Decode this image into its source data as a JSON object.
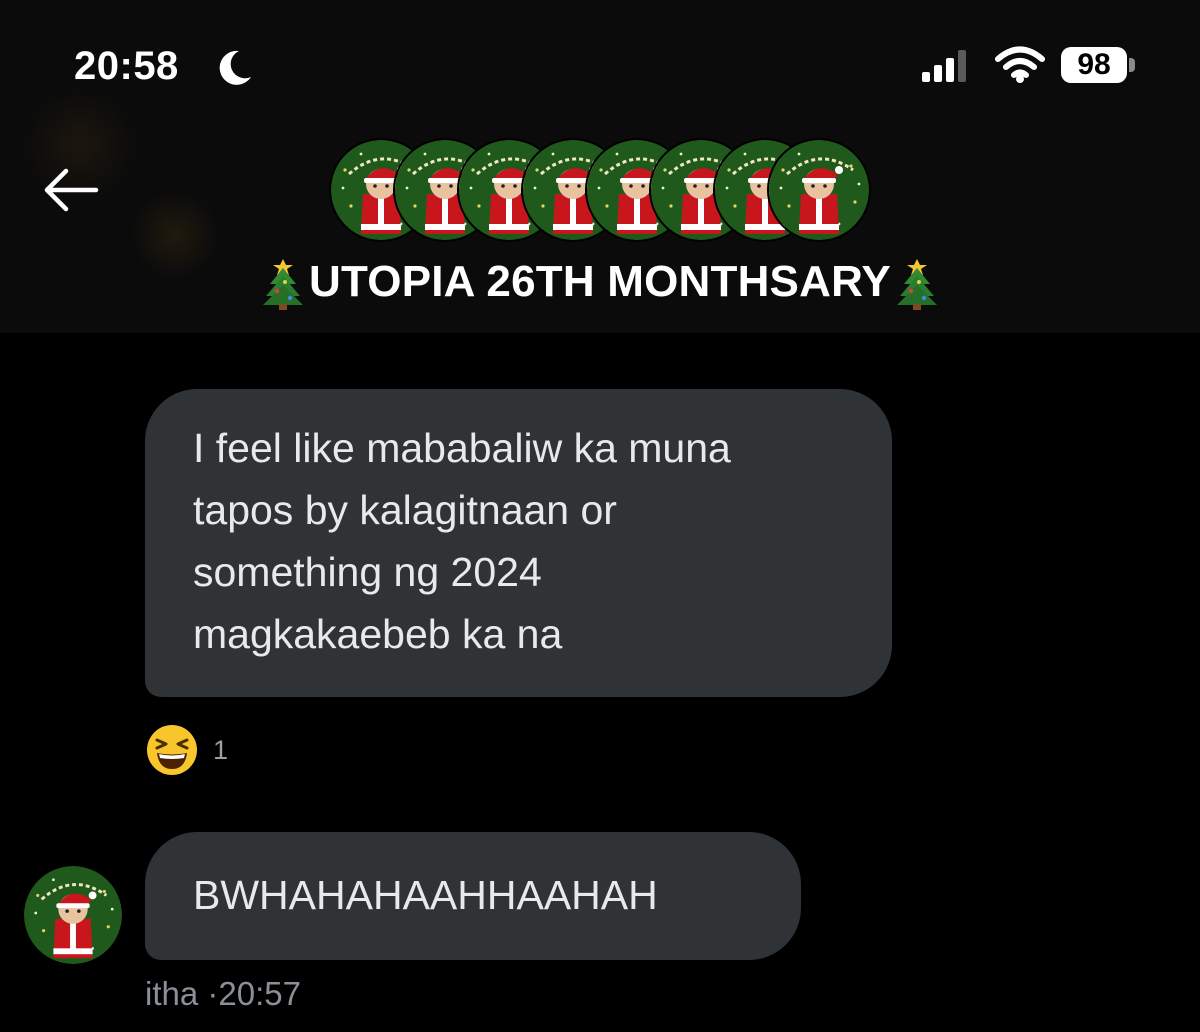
{
  "status_bar": {
    "time": "20:58",
    "battery": "98",
    "icons": [
      "moon-icon",
      "cellular-signal-icon",
      "wifi-icon",
      "battery-icon"
    ]
  },
  "header": {
    "title": "UTOPIA 26TH MONTHSARY",
    "title_emoji": "christmas-tree",
    "back_icon": "back-arrow-icon",
    "avatar_count": 8
  },
  "messages": [
    {
      "lines": [
        "I feel like mababaliw ka muna",
        "tapos by kalagitnaan or",
        "something ng 2024",
        "magkakaebeb ka na"
      ],
      "reaction": {
        "emoji": "laughing-face",
        "count": "1"
      }
    },
    {
      "text": "BWHAHAHAAHHAAHAH",
      "sender": "itha",
      "time": "·20:57"
    }
  ],
  "colors": {
    "background": "#000000",
    "header_background": "#0b0b0b",
    "bubble": "#2f3336",
    "bubble_text": "#e7e9ea",
    "meta_text": "#8b9096",
    "avatar_green": "#1f5a1c",
    "santa_red": "#c8161d"
  }
}
